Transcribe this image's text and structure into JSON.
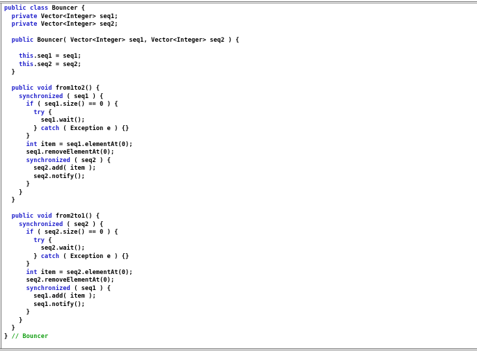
{
  "document": {
    "type": "source-code-listing",
    "language": "Java",
    "class_name": "Bouncer",
    "colors": {
      "keyword": "#2222cc",
      "comment": "#15a015",
      "plain": "#000000",
      "rule": "#6e6e6e",
      "background": "#ffffff"
    },
    "trailing_comment": "// Bouncer",
    "lines": [
      [
        {
          "t": "public",
          "c": "kw"
        },
        {
          "t": " ",
          "c": "pln"
        },
        {
          "t": "class",
          "c": "kw"
        },
        {
          "t": " Bouncer {",
          "c": "pln"
        }
      ],
      [
        {
          "t": "  ",
          "c": "pln"
        },
        {
          "t": "private",
          "c": "kw"
        },
        {
          "t": " Vector<Integer> seq1;",
          "c": "pln"
        }
      ],
      [
        {
          "t": "  ",
          "c": "pln"
        },
        {
          "t": "private",
          "c": "kw"
        },
        {
          "t": " Vector<Integer> seq2;",
          "c": "pln"
        }
      ],
      [],
      [
        {
          "t": "  ",
          "c": "pln"
        },
        {
          "t": "public",
          "c": "kw"
        },
        {
          "t": " Bouncer( Vector<Integer> seq1, Vector<Integer> seq2 ) {",
          "c": "pln"
        }
      ],
      [],
      [
        {
          "t": "    ",
          "c": "pln"
        },
        {
          "t": "this",
          "c": "kw"
        },
        {
          "t": ".seq1 = seq1;",
          "c": "pln"
        }
      ],
      [
        {
          "t": "    ",
          "c": "pln"
        },
        {
          "t": "this",
          "c": "kw"
        },
        {
          "t": ".seq2 = seq2;",
          "c": "pln"
        }
      ],
      [
        {
          "t": "  }",
          "c": "pln"
        }
      ],
      [],
      [
        {
          "t": "  ",
          "c": "pln"
        },
        {
          "t": "public",
          "c": "kw"
        },
        {
          "t": " ",
          "c": "pln"
        },
        {
          "t": "void",
          "c": "kw"
        },
        {
          "t": " from1to2() {",
          "c": "pln"
        }
      ],
      [
        {
          "t": "    ",
          "c": "pln"
        },
        {
          "t": "synchronized",
          "c": "kw"
        },
        {
          "t": " ( seq1 ) {",
          "c": "pln"
        }
      ],
      [
        {
          "t": "      ",
          "c": "pln"
        },
        {
          "t": "if",
          "c": "kw"
        },
        {
          "t": " ( seq1.size() == 0 ) {",
          "c": "pln"
        }
      ],
      [
        {
          "t": "        ",
          "c": "pln"
        },
        {
          "t": "try",
          "c": "kw"
        },
        {
          "t": " {",
          "c": "pln"
        }
      ],
      [
        {
          "t": "          seq1.wait();",
          "c": "pln"
        }
      ],
      [
        {
          "t": "        } ",
          "c": "pln"
        },
        {
          "t": "catch",
          "c": "kw"
        },
        {
          "t": " ( Exception e ) {}",
          "c": "pln"
        }
      ],
      [
        {
          "t": "      }",
          "c": "pln"
        }
      ],
      [
        {
          "t": "      ",
          "c": "pln"
        },
        {
          "t": "int",
          "c": "kw"
        },
        {
          "t": " item = seq1.elementAt(0);",
          "c": "pln"
        }
      ],
      [
        {
          "t": "      seq1.removeElementAt(0);",
          "c": "pln"
        }
      ],
      [
        {
          "t": "      ",
          "c": "pln"
        },
        {
          "t": "synchronized",
          "c": "kw"
        },
        {
          "t": " ( seq2 ) {",
          "c": "pln"
        }
      ],
      [
        {
          "t": "        seq2.add( item );",
          "c": "pln"
        }
      ],
      [
        {
          "t": "        seq2.notify();",
          "c": "pln"
        }
      ],
      [
        {
          "t": "      }",
          "c": "pln"
        }
      ],
      [
        {
          "t": "    }",
          "c": "pln"
        }
      ],
      [
        {
          "t": "  }",
          "c": "pln"
        }
      ],
      [],
      [
        {
          "t": "  ",
          "c": "pln"
        },
        {
          "t": "public",
          "c": "kw"
        },
        {
          "t": " ",
          "c": "pln"
        },
        {
          "t": "void",
          "c": "kw"
        },
        {
          "t": " from2to1() {",
          "c": "pln"
        }
      ],
      [
        {
          "t": "    ",
          "c": "pln"
        },
        {
          "t": "synchronized",
          "c": "kw"
        },
        {
          "t": " ( seq2 ) {",
          "c": "pln"
        }
      ],
      [
        {
          "t": "      ",
          "c": "pln"
        },
        {
          "t": "if",
          "c": "kw"
        },
        {
          "t": " ( seq2.size() == 0 ) {",
          "c": "pln"
        }
      ],
      [
        {
          "t": "        ",
          "c": "pln"
        },
        {
          "t": "try",
          "c": "kw"
        },
        {
          "t": " {",
          "c": "pln"
        }
      ],
      [
        {
          "t": "          seq2.wait();",
          "c": "pln"
        }
      ],
      [
        {
          "t": "        } ",
          "c": "pln"
        },
        {
          "t": "catch",
          "c": "kw"
        },
        {
          "t": " ( Exception e ) {}",
          "c": "pln"
        }
      ],
      [
        {
          "t": "      }",
          "c": "pln"
        }
      ],
      [
        {
          "t": "      ",
          "c": "pln"
        },
        {
          "t": "int",
          "c": "kw"
        },
        {
          "t": " item = seq2.elementAt(0);",
          "c": "pln"
        }
      ],
      [
        {
          "t": "      seq2.removeElementAt(0);",
          "c": "pln"
        }
      ],
      [
        {
          "t": "      ",
          "c": "pln"
        },
        {
          "t": "synchronized",
          "c": "kw"
        },
        {
          "t": " ( seq1 ) {",
          "c": "pln"
        }
      ],
      [
        {
          "t": "        seq1.add( item );",
          "c": "pln"
        }
      ],
      [
        {
          "t": "        seq1.notify();",
          "c": "pln"
        }
      ],
      [
        {
          "t": "      }",
          "c": "pln"
        }
      ],
      [
        {
          "t": "    }",
          "c": "pln"
        }
      ],
      [
        {
          "t": "  }",
          "c": "pln"
        }
      ],
      [
        {
          "t": "} ",
          "c": "pln"
        },
        {
          "t": "// Bouncer",
          "c": "cmt"
        }
      ]
    ]
  }
}
